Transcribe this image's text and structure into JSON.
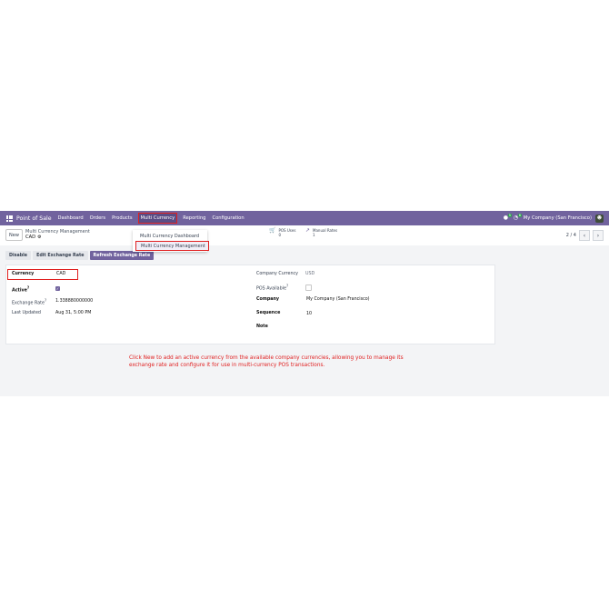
{
  "navbar": {
    "app_title": "Point of Sale",
    "menus": [
      "Dashboard",
      "Orders",
      "Products",
      "Multi Currency",
      "Reporting",
      "Configuration"
    ],
    "active_menu": "Multi Currency",
    "chat_badge": "5",
    "activity_badge": "6",
    "company": "My Company (San Francisco)"
  },
  "control_panel": {
    "new_label": "New",
    "breadcrumb_parent": "Multi Currency Management",
    "breadcrumb_current": "CAD",
    "pos_uses_label": "POS Uses",
    "pos_uses_value": "0",
    "manual_rates_label": "Manual Rates",
    "manual_rates_value": "1",
    "pager": "2 / 4"
  },
  "dropdown": {
    "items": [
      "Multi Currency Dashboard",
      "Multi Currency Management"
    ],
    "selected": "Multi Currency Management"
  },
  "actions": {
    "disable": "Disable",
    "edit_rate": "Edit Exchange Rate",
    "refresh_rate": "Refresh Exchange Rate"
  },
  "form": {
    "currency_label": "Currency",
    "currency_value": "CAD",
    "active_label": "Active",
    "active_checked": true,
    "exchange_rate_label": "Exchange Rate",
    "exchange_rate_value": "1.338880000000",
    "last_updated_label": "Last Updated",
    "last_updated_value": "Aug 31, 5:00 PM",
    "company_currency_label": "Company Currency",
    "company_currency_value": "USD",
    "pos_available_label": "POS Available",
    "pos_available_checked": false,
    "company_label": "Company",
    "company_value": "My Company (San Francisco)",
    "sequence_label": "Sequence",
    "sequence_value": "10",
    "note_label": "Note",
    "help_mark": "?"
  },
  "annotation": "Click New to add an active currency from the available company currencies, allowing you to manage its exchange rate and configure it for use in multi-currency POS transactions.",
  "colors": {
    "brand": "#71639e",
    "highlight": "#e02020"
  }
}
